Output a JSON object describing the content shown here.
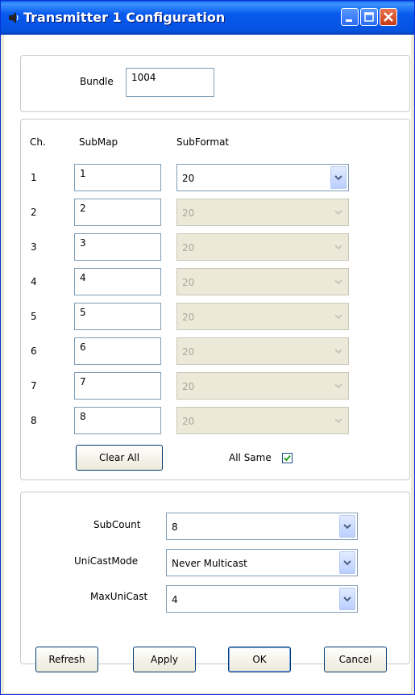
{
  "window": {
    "title": "Transmitter 1 Configuration",
    "icon": "speaker-icon"
  },
  "bundle": {
    "label": "Bundle",
    "value": "1004"
  },
  "channels": {
    "header_ch": "Ch.",
    "header_submap": "SubMap",
    "header_subformat": "SubFormat",
    "rows": [
      {
        "ch": "1",
        "submap": "1",
        "subformat": "20",
        "enabled": true
      },
      {
        "ch": "2",
        "submap": "2",
        "subformat": "20",
        "enabled": false
      },
      {
        "ch": "3",
        "submap": "3",
        "subformat": "20",
        "enabled": false
      },
      {
        "ch": "4",
        "submap": "4",
        "subformat": "20",
        "enabled": false
      },
      {
        "ch": "5",
        "submap": "5",
        "subformat": "20",
        "enabled": false
      },
      {
        "ch": "6",
        "submap": "6",
        "subformat": "20",
        "enabled": false
      },
      {
        "ch": "7",
        "submap": "7",
        "subformat": "20",
        "enabled": false
      },
      {
        "ch": "8",
        "submap": "8",
        "subformat": "20",
        "enabled": false
      }
    ],
    "clear_all_label": "Clear All",
    "all_same_label": "All Same",
    "all_same_checked": true
  },
  "settings": {
    "subcount_label": "SubCount",
    "subcount_value": "8",
    "unicast_label": "UniCastMode",
    "unicast_value": "Never Multicast",
    "maxunicast_label": "MaxUniCast",
    "maxunicast_value": "4"
  },
  "footer": {
    "refresh": "Refresh",
    "apply": "Apply",
    "ok": "OK",
    "cancel": "Cancel"
  },
  "colors": {
    "titlebar": "#0553e0",
    "disabled_fill": "#ece9d8",
    "checkmark": "#21a121"
  }
}
